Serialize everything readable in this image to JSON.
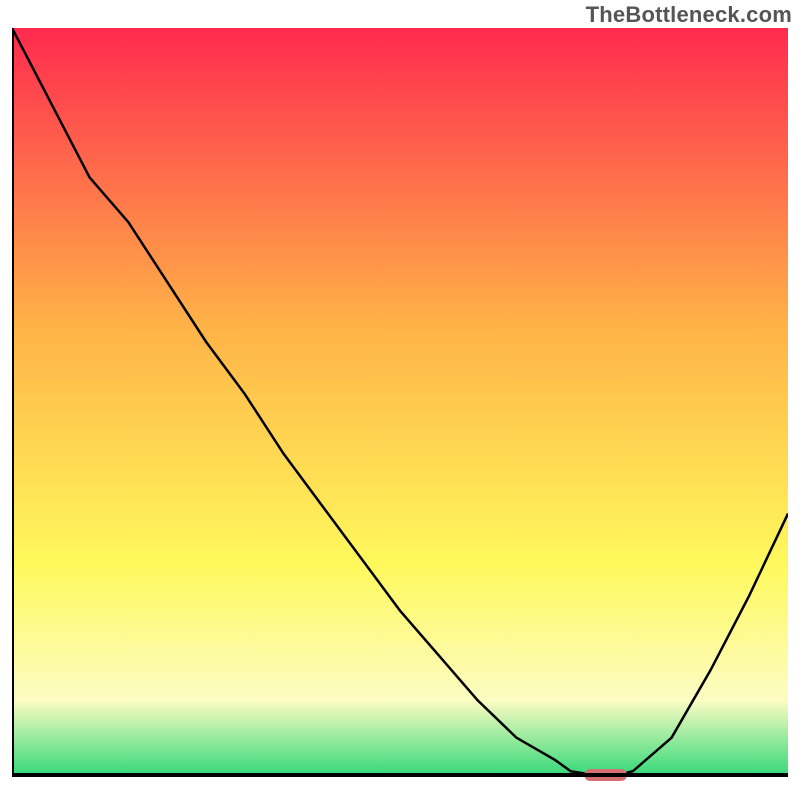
{
  "watermark": "TheBottleneck.com",
  "colors": {
    "gradient_top": "#ff2a4f",
    "gradient_mid_upper": "#ffb347",
    "gradient_mid_lower": "#fff95d",
    "gradient_pale": "#fcfcc3",
    "gradient_green": "#36d97b",
    "line": "#000000",
    "axis": "#000000",
    "marker": "#d66f74",
    "watermark": "#555555"
  },
  "chart_data": {
    "type": "line",
    "title": "",
    "xlabel": "",
    "ylabel": "",
    "x": [
      0.0,
      0.02,
      0.05,
      0.1,
      0.15,
      0.2,
      0.25,
      0.3,
      0.35,
      0.4,
      0.45,
      0.5,
      0.55,
      0.6,
      0.65,
      0.7,
      0.72,
      0.75,
      0.78,
      0.8,
      0.85,
      0.9,
      0.95,
      1.0
    ],
    "values": [
      100,
      96,
      90,
      80,
      74,
      66,
      58,
      51,
      43,
      36,
      29,
      22,
      16,
      10,
      5,
      2,
      0.5,
      0,
      0,
      0.5,
      5,
      14,
      24,
      35
    ],
    "xlim": [
      0,
      1
    ],
    "ylim": [
      0,
      100
    ],
    "minimum_marker": {
      "x_center": 0.765,
      "y": 0,
      "width": 0.055
    }
  }
}
